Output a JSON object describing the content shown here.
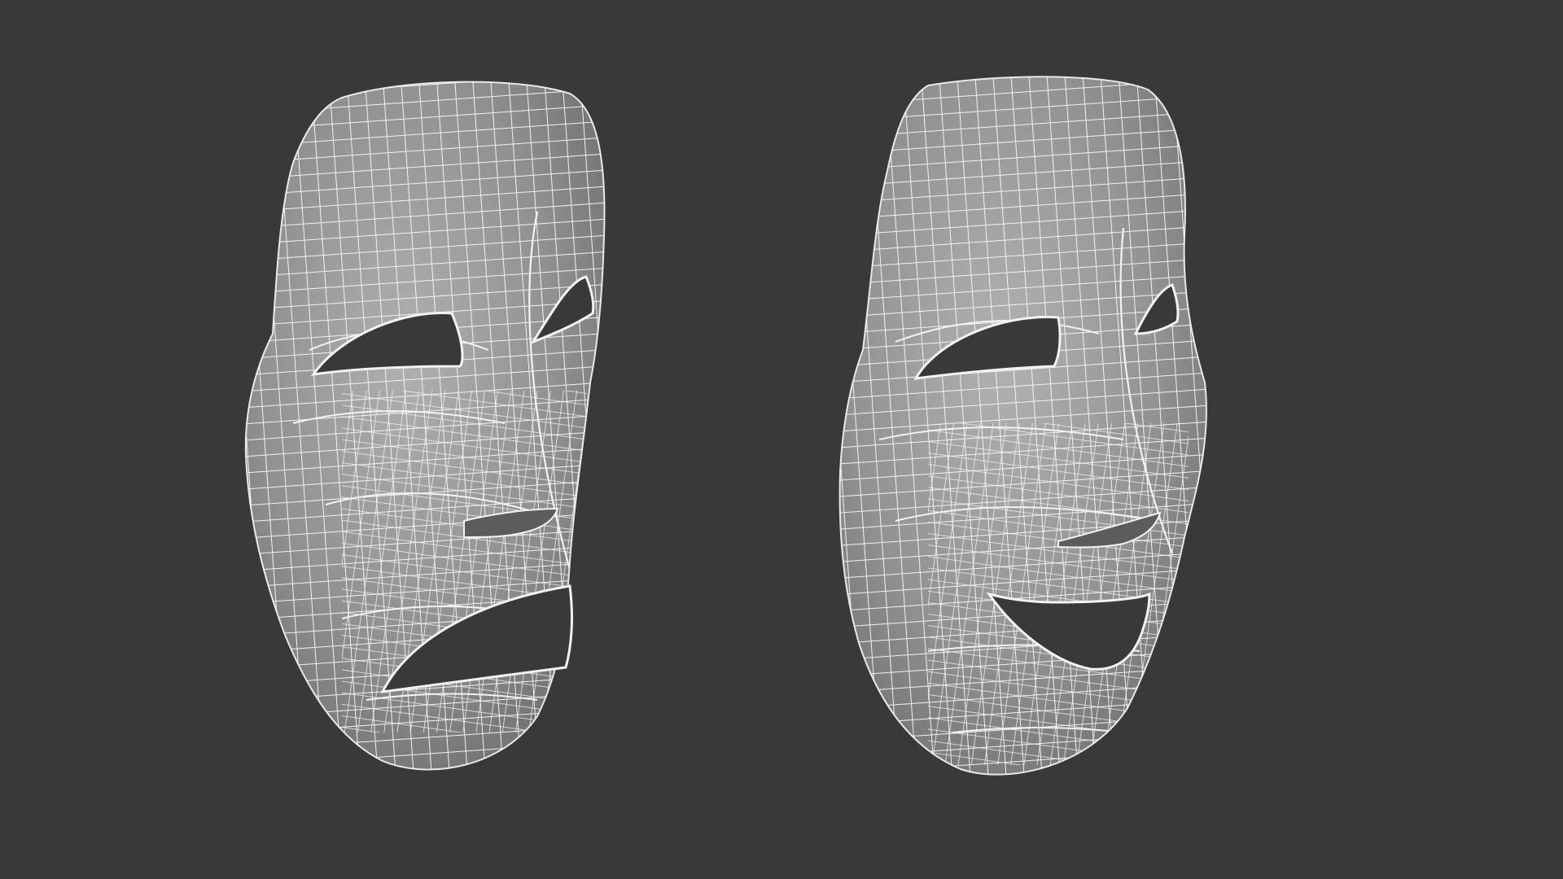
{
  "viewport": {
    "background_color": "#393939"
  },
  "materials": {
    "mesh_fill": "#8c8c8c",
    "mesh_fill_light": "#a8a8a8",
    "mesh_fill_dark": "#6e6e6e",
    "wireframe_color": "#f4f4f4",
    "hole_color": "#393939",
    "inner_shadow": "#5a5a5a"
  },
  "models": [
    {
      "id": "tragedy",
      "object_name": "tragedy-mask",
      "expression": "sad"
    },
    {
      "id": "comedy",
      "object_name": "comedy-mask",
      "expression": "happy"
    }
  ]
}
